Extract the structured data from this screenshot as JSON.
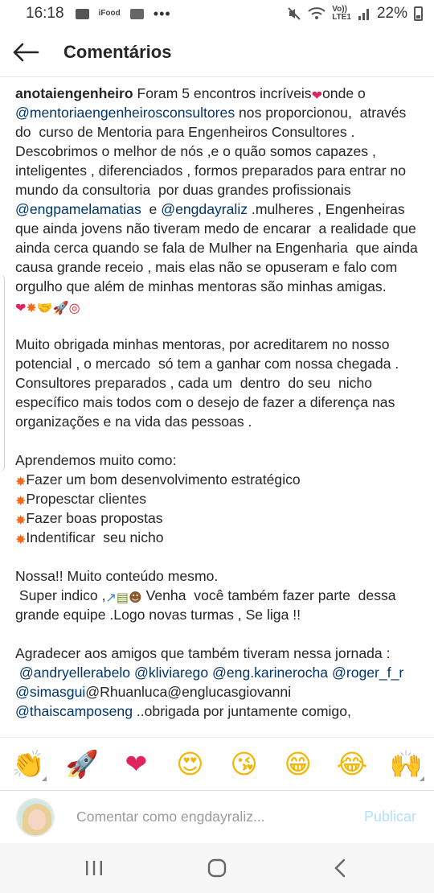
{
  "status_bar": {
    "time": "16:18",
    "left_icons": [
      "mail-icon",
      "news-icon",
      "image-icon"
    ],
    "more": "•••",
    "network": "Vo))\nLTE1",
    "battery": "22%"
  },
  "app_bar": {
    "title": "Comentários"
  },
  "caption": {
    "username": "anotaiengenheiro",
    "p1a": " Foram 5 encontros incríveis",
    "p1b": "onde o ",
    "m1": "@mentoriaengenheirosconsultores",
    "p1c": " nos proporcionou,  através do  curso de Mentoria para Engenheiros Consultores . Descobrimos o melhor de nós ,e o quão somos capazes , inteligentes , diferenciados , formos preparados para entrar no mundo da consultoria  por duas grandes profissionais ",
    "m2": "@engpamelamatias",
    "p1d": "  e ",
    "m3": "@engdayraliz",
    "p1e": " .mulheres , Engenheiras que ainda jovens não tiveram medo de encarar  a realidade que ainda cerca quando se fala de Mulher na Engenharia  que ainda causa grande receio , mais elas não se opuseram e falo com orgulho que além de minhas mentoras são minhas amigas.",
    "p2": "Muito obrigada minhas mentoras, por acreditarem no nosso potencial , o mercado  só tem a ganhar com nossa chegada . Consultores preparados , cada um  dentro  do seu  nicho específico mais todos com o desejo de fazer a diferença nas organizações e na vida das pessoas .",
    "p3_title": "Aprendemos muito como:",
    "list": [
      "Fazer um bom desenvolvimento estratégico",
      "Propesctar clientes",
      "Fazer boas propostas",
      "Indentificar  seu nicho"
    ],
    "p4a": "Nossa!! Muito conteúdo mesmo.",
    "p4b": " Super indico ,",
    "p4c": " Venha  você também fazer parte  dessa grande equipe .Logo novas turmas , Se liga !!",
    "p5": "Agradecer aos amigos que também tiveram nessa jornada :",
    "m4": "@andryellerabelo",
    "m5": "@kliviarego",
    "m6": "@eng.karinerocha",
    "m7": "@roger_f_r",
    "m8": "@simasgui",
    "t8": "@Rhuanluca@englucasgiovanni",
    "m9": "@thaiscamposeng",
    "t9": " ..obrigada por juntamente comigo,"
  },
  "emoji": {
    "heart": "❤",
    "boom": "✸",
    "shake": "🤝",
    "rocket": "🚀",
    "target": "◎",
    "chart": "↗",
    "books": "▤",
    "face": "☻"
  },
  "reactions": [
    {
      "name": "clapping-hands",
      "glyph": "👏",
      "color": "#e8b63b"
    },
    {
      "name": "rocket",
      "glyph": "🚀",
      "color": "#c0392b"
    },
    {
      "name": "red-heart",
      "glyph": "❤",
      "color": "#e0245e"
    },
    {
      "name": "heart-eyes",
      "glyph": "😍",
      "color": "#f4b400"
    },
    {
      "name": "kissing-face",
      "glyph": "😘",
      "color": "#f4b400"
    },
    {
      "name": "grinning-face",
      "glyph": "😁",
      "color": "#f4b400"
    },
    {
      "name": "tears-of-joy",
      "glyph": "😂",
      "color": "#f4b400"
    },
    {
      "name": "raising-hands",
      "glyph": "🙌",
      "color": "#e8b63b"
    }
  ],
  "comment_bar": {
    "placeholder": "Comentar como engdayraliz...",
    "publish_label": "Publicar"
  },
  "colors": {
    "mention": "#003569",
    "publish_disabled": "#b2dffc",
    "heart": "#e0245e"
  }
}
